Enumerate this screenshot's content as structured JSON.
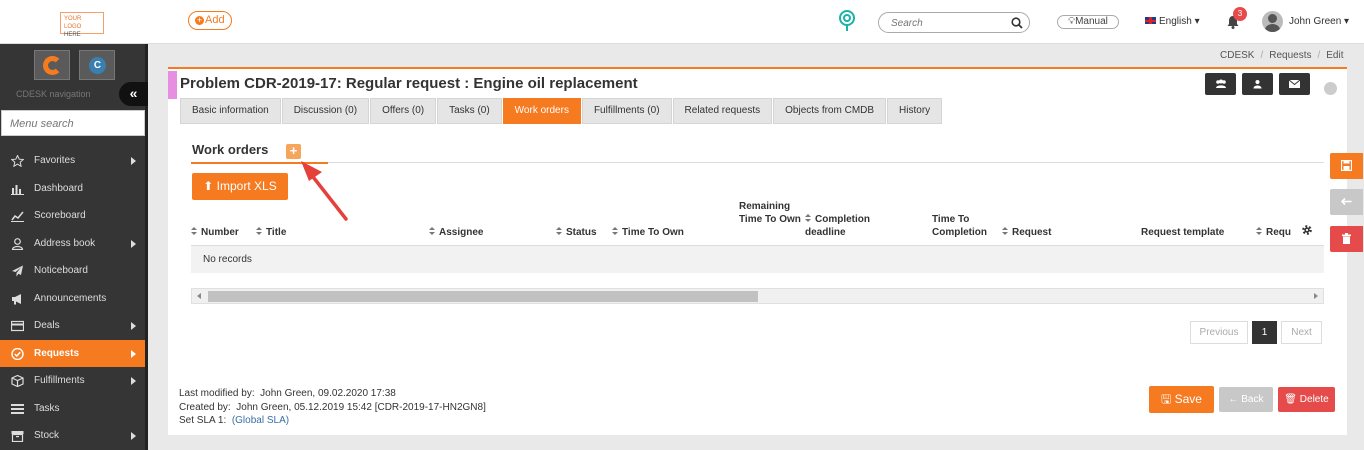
{
  "topbar": {
    "logo_line1": "YOUR LOGO",
    "logo_line2": "HERE",
    "add_label": "Add",
    "search_placeholder": "Search",
    "manual_label": "Manual",
    "language": "English",
    "notifications_count": "3",
    "user_name": "John Green"
  },
  "sidebar": {
    "nav_title": "CDESK navigation",
    "collapse_label": "«",
    "search_placeholder": "Menu search",
    "items": [
      {
        "label": "Favorites",
        "icon": "star-icon",
        "arrow": true
      },
      {
        "label": "Dashboard",
        "icon": "bar-chart-icon",
        "arrow": false
      },
      {
        "label": "Scoreboard",
        "icon": "line-chart-icon",
        "arrow": false
      },
      {
        "label": "Address book",
        "icon": "person-icon",
        "arrow": true
      },
      {
        "label": "Noticeboard",
        "icon": "paper-plane-icon",
        "arrow": false
      },
      {
        "label": "Announcements",
        "icon": "megaphone-icon",
        "arrow": false
      },
      {
        "label": "Deals",
        "icon": "card-icon",
        "arrow": true
      },
      {
        "label": "Requests",
        "icon": "check-circle-icon",
        "arrow": true,
        "active": true
      },
      {
        "label": "Fulfillments",
        "icon": "cube-icon",
        "arrow": true
      },
      {
        "label": "Tasks",
        "icon": "list-icon",
        "arrow": false
      },
      {
        "label": "Stock",
        "icon": "box-icon",
        "arrow": true
      }
    ]
  },
  "breadcrumb": [
    "CDESK",
    "Requests",
    "Edit"
  ],
  "page": {
    "title": "Problem CDR-2019-17: Regular request : Engine oil replacement",
    "tabs": [
      {
        "label": "Basic information"
      },
      {
        "label": "Discussion (0)"
      },
      {
        "label": "Offers (0)"
      },
      {
        "label": "Tasks (0)"
      },
      {
        "label": "Work orders",
        "active": true
      },
      {
        "label": "Fulfillments (0)"
      },
      {
        "label": "Related requests"
      },
      {
        "label": "Objects from CMDB"
      },
      {
        "label": "History"
      }
    ],
    "section_title": "Work orders",
    "import_label": "Import XLS",
    "columns": [
      "Number",
      "Title",
      "Assignee",
      "Status",
      "Time To Own",
      "Remaining Time To Own",
      "Completion deadline",
      "Time To Completion",
      "Request",
      "Request template",
      "Requ"
    ],
    "no_records": "No records",
    "pager": {
      "previous": "Previous",
      "current": "1",
      "next": "Next"
    },
    "meta": {
      "modified_label": "Last modified by:",
      "modified_value": "John Green,  09.02.2020 17:38",
      "created_label": "Created by:",
      "created_value": "John Green,  05.12.2019 15:42 [CDR-2019-17-HN2GN8]",
      "sla_label": "Set SLA 1:",
      "sla_value": "(Global SLA)"
    },
    "buttons": {
      "save": "Save",
      "back": "Back",
      "delete": "Delete"
    }
  },
  "colors": {
    "accent": "#f57a20",
    "danger": "#e54b4b",
    "sidebar": "#353535"
  }
}
